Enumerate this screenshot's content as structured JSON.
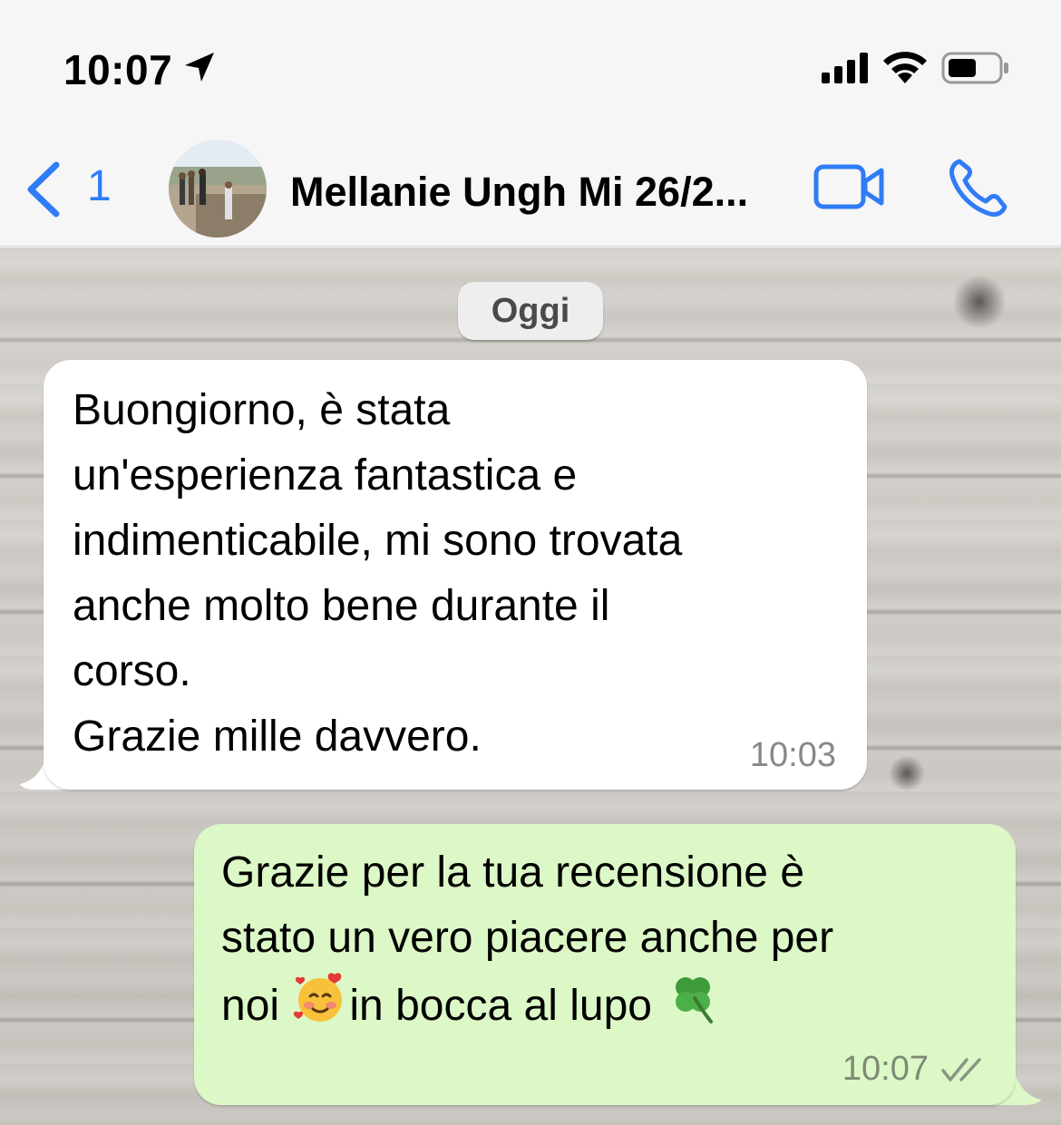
{
  "status_bar": {
    "time": "10:07",
    "icons": [
      "location-arrow-icon",
      "cellular-signal-icon",
      "wifi-icon",
      "battery-icon"
    ]
  },
  "header": {
    "back_count": "1",
    "contact_name": "Mellanie Ungh Mi 26/2...",
    "accent_color": "#2f7cf6",
    "icons": [
      "chevron-left-icon",
      "avatar",
      "video-call-icon",
      "phone-icon"
    ]
  },
  "chat": {
    "date_label": "Oggi",
    "messages": [
      {
        "direction": "incoming",
        "text": "Buongiorno, è stata\nun'esperienza fantastica e\nindimenticabile, mi sono trovata\nanche molto bene durante il\ncorso.\nGrazie mille davvero.",
        "time": "10:03",
        "bubble_color": "#ffffff"
      },
      {
        "direction": "outgoing",
        "text_line1": "Grazie per la tua recensione è",
        "text_line2": "stato un vero piacere anche per",
        "text_line3_a": "noi ",
        "text_line3_b": "in bocca al lupo ",
        "emojis": [
          "smiling-face-with-hearts",
          "four-leaf-clover"
        ],
        "time": "10:07",
        "status": "delivered",
        "bubble_color": "#dcf8c6"
      }
    ]
  }
}
